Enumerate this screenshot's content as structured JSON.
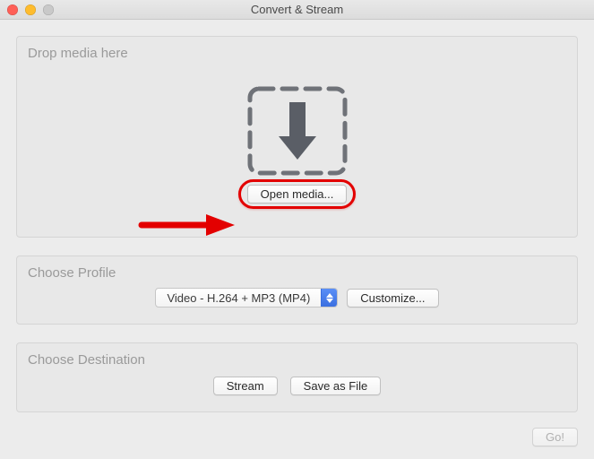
{
  "window": {
    "title": "Convert & Stream"
  },
  "drop": {
    "legend": "Drop media here",
    "open_media_label": "Open media..."
  },
  "profile": {
    "legend": "Choose Profile",
    "selected": "Video - H.264 + MP3 (MP4)",
    "customize_label": "Customize..."
  },
  "destination": {
    "legend": "Choose Destination",
    "stream_label": "Stream",
    "save_label": "Save as File"
  },
  "footer": {
    "go_label": "Go!"
  },
  "annotation": {
    "arrow_target": "open-media-button"
  }
}
